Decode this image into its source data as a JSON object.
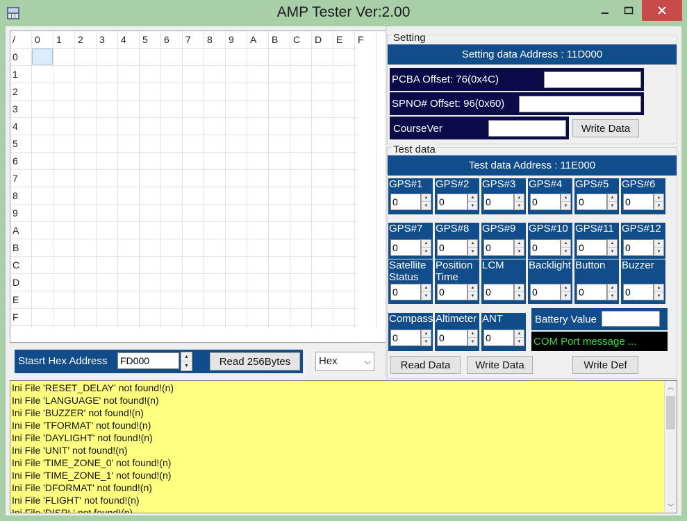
{
  "window": {
    "title": "AMP Tester Ver:2.00"
  },
  "grid": {
    "corner": "/",
    "columns": [
      "0",
      "1",
      "2",
      "3",
      "4",
      "5",
      "6",
      "7",
      "8",
      "9",
      "A",
      "B",
      "C",
      "D",
      "E",
      "F"
    ],
    "rows": [
      "0",
      "1",
      "2",
      "3",
      "4",
      "5",
      "6",
      "7",
      "8",
      "9",
      "A",
      "B",
      "C",
      "D",
      "E",
      "F"
    ]
  },
  "read_controls": {
    "start_label": "Stasrt Hex Address",
    "start_value": "FD000",
    "read_button": "Read 256Bytes",
    "format_selected": "Hex"
  },
  "setting": {
    "group_title": "Setting",
    "address_label": "Setting data Address : 11D000",
    "pcba_label": "PCBA Offset: 76(0x4C)",
    "pcba_value": "",
    "spno_label": "SPNO# Offset: 96(0x60)",
    "spno_value": "",
    "course_label": "CourseVer",
    "course_value": "",
    "write_button": "Write Data"
  },
  "test": {
    "group_title": "Test data",
    "address_label": "Test data Address : 11E000",
    "row1": [
      {
        "label": "GPS#1",
        "value": "0"
      },
      {
        "label": "GPS#2",
        "value": "0"
      },
      {
        "label": "GPS#3",
        "value": "0"
      },
      {
        "label": "GPS#4",
        "value": "0"
      },
      {
        "label": "GPS#5",
        "value": "0"
      },
      {
        "label": "GPS#6",
        "value": "0"
      }
    ],
    "row2": [
      {
        "label": "GPS#7",
        "value": "0"
      },
      {
        "label": "GPS#8",
        "value": "0"
      },
      {
        "label": "GPS#9",
        "value": "0"
      },
      {
        "label": "GPS#10",
        "value": "0"
      },
      {
        "label": "GPS#11",
        "value": "0"
      },
      {
        "label": "GPS#12",
        "value": "0"
      }
    ],
    "row3": [
      {
        "label1": "Satellite",
        "label2": "Status",
        "value": "0"
      },
      {
        "label1": "Position",
        "label2": "Time",
        "value": "0"
      },
      {
        "label1": "LCM",
        "label2": "",
        "value": "0"
      },
      {
        "label1": "Backlight",
        "label2": "",
        "value": "0"
      },
      {
        "label1": "Button",
        "label2": "",
        "value": "0"
      },
      {
        "label1": "Buzzer",
        "label2": "",
        "value": "0"
      }
    ],
    "row4": [
      {
        "label": "Compass",
        "value": "0"
      },
      {
        "label": "Altimeter",
        "value": "0"
      },
      {
        "label": "ANT",
        "value": "0"
      }
    ],
    "battery_label": "Battery Value",
    "battery_value": "",
    "com_message": "COM Port message ...",
    "read_button": "Read Data",
    "write_button": "Write Data",
    "write_def_button": "Write Def"
  },
  "log": {
    "lines": [
      "Ini File 'RESET_DELAY' not found!(n)",
      "Ini File 'LANGUAGE' not found!(n)",
      "Ini File 'BUZZER' not found!(n)",
      "Ini File 'TFORMAT' not found!(n)",
      "Ini File 'DAYLIGHT' not found!(n)",
      "Ini File 'UNIT' not found!(n)",
      "Ini File 'TIME_ZONE_0' not found!(n)",
      "Ini File 'TIME_ZONE_1' not found!(n)",
      "Ini File 'DFORMAT' not found!(n)",
      "Ini File 'FLIGHT' not found!(n)",
      "Ini File 'DISPL' not found!(n)"
    ]
  },
  "colors": {
    "panel_blue": "#104d8a",
    "navy": "#0b0b4a",
    "log_bg": "#ffff80",
    "com_text": "#3cdc3c",
    "titlebar": "#a9cfa9"
  }
}
